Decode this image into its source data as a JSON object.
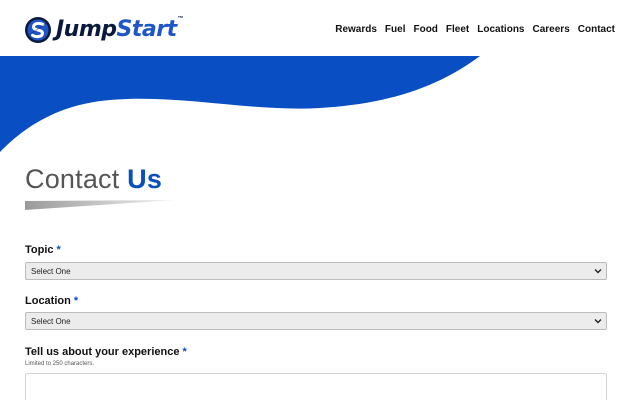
{
  "brand": {
    "name_part1": "Jump",
    "name_part2": "Start",
    "trademark": "™",
    "logo_icon": "jumpstart-s-logo-icon",
    "colors": {
      "navy": "#0b1a3c",
      "blue": "#1e56c8",
      "accent": "#0b4fbf",
      "wave": "#0a4ec3"
    }
  },
  "nav": {
    "items": [
      "Rewards",
      "Fuel",
      "Food",
      "Fleet",
      "Locations",
      "Careers",
      "Contact"
    ]
  },
  "page": {
    "title_part1": "Contact ",
    "title_part2": "Us"
  },
  "form": {
    "required_mark": "*",
    "topic": {
      "label": "Topic",
      "value": "Select One",
      "icon": "chevron-down-icon"
    },
    "location": {
      "label": "Location",
      "value": "Select One",
      "icon": "chevron-down-icon"
    },
    "experience": {
      "label": "Tell us about your experience",
      "hint": "Limited to 250 characters.",
      "value": ""
    }
  }
}
